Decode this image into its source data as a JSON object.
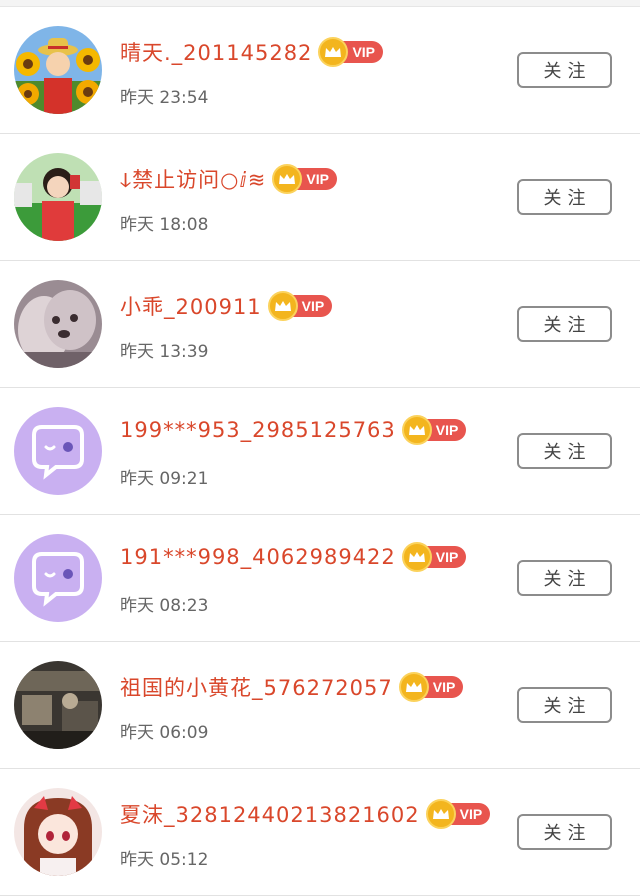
{
  "follow_label": "关注",
  "vip_label": "VIP",
  "colors": {
    "name": "#d9472b",
    "vip_badge": "#e8554e",
    "crown": "#f3b51e",
    "default_avatar": "#c9b0f1"
  },
  "users": [
    {
      "name": "晴天._201145282",
      "time": "昨天 23:54",
      "avatar": "sunflower-cartoon-avatar"
    },
    {
      "name": "ↆ禁止访问○ⅈ≋",
      "time": "昨天 18:08",
      "avatar": "girl-photo-avatar"
    },
    {
      "name": "小乖_200911",
      "time": "昨天 13:39",
      "avatar": "puppy-photo-avatar"
    },
    {
      "name": "199***953_2985125763",
      "time": "昨天 09:21",
      "avatar": "default-chat-avatar"
    },
    {
      "name": "191***998_4062989422",
      "time": "昨天 08:23",
      "avatar": "default-chat-avatar"
    },
    {
      "name": "祖国的小黄花_576272057",
      "time": "昨天 06:09",
      "avatar": "dark-photo-avatar"
    },
    {
      "name": "夏沫_32812440213821602",
      "time": "昨天 05:12",
      "avatar": "anime-girl-avatar"
    }
  ]
}
